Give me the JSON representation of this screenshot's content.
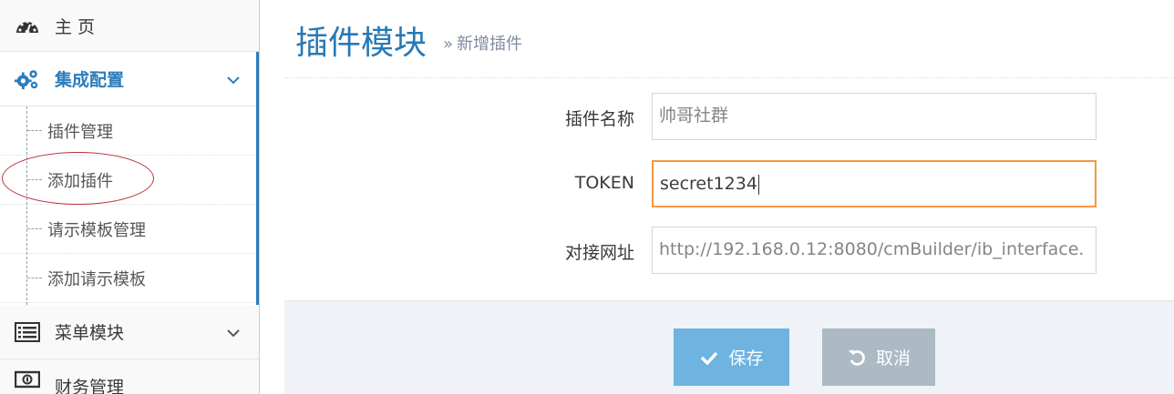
{
  "sidebar": {
    "home": {
      "label": "主 页",
      "icon": "dashboard-gauge-icon"
    },
    "integration": {
      "label": "集成配置",
      "icon": "cogs-icon",
      "expanded": true
    },
    "submenu": [
      {
        "label": "插件管理"
      },
      {
        "label": "添加插件"
      },
      {
        "label": "请示模板管理"
      },
      {
        "label": "添加请示模板"
      }
    ],
    "menu_module": {
      "label": "菜单模块",
      "icon": "list-icon"
    },
    "finance": {
      "label": "财务管理",
      "icon": "money-icon"
    }
  },
  "header": {
    "title": "插件模块",
    "separator": "»",
    "subtitle": "新增插件"
  },
  "form": {
    "plugin_name": {
      "label": "插件名称",
      "placeholder": "帅哥社群",
      "value": ""
    },
    "token": {
      "label": "TOKEN",
      "value": "secret1234"
    },
    "endpoint": {
      "label": "对接网址",
      "placeholder": "http://192.168.0.12:8080/cmBuilder/ib_interface.",
      "value": ""
    }
  },
  "actions": {
    "save_label": "保存",
    "cancel_label": "取消"
  },
  "colors": {
    "accent": "#2b7dbc",
    "title": "#2679b5",
    "save_button": "#6fb3e0",
    "cancel_button": "#abbac3",
    "focus_border": "#f59942",
    "annotation": "#b8303a"
  }
}
